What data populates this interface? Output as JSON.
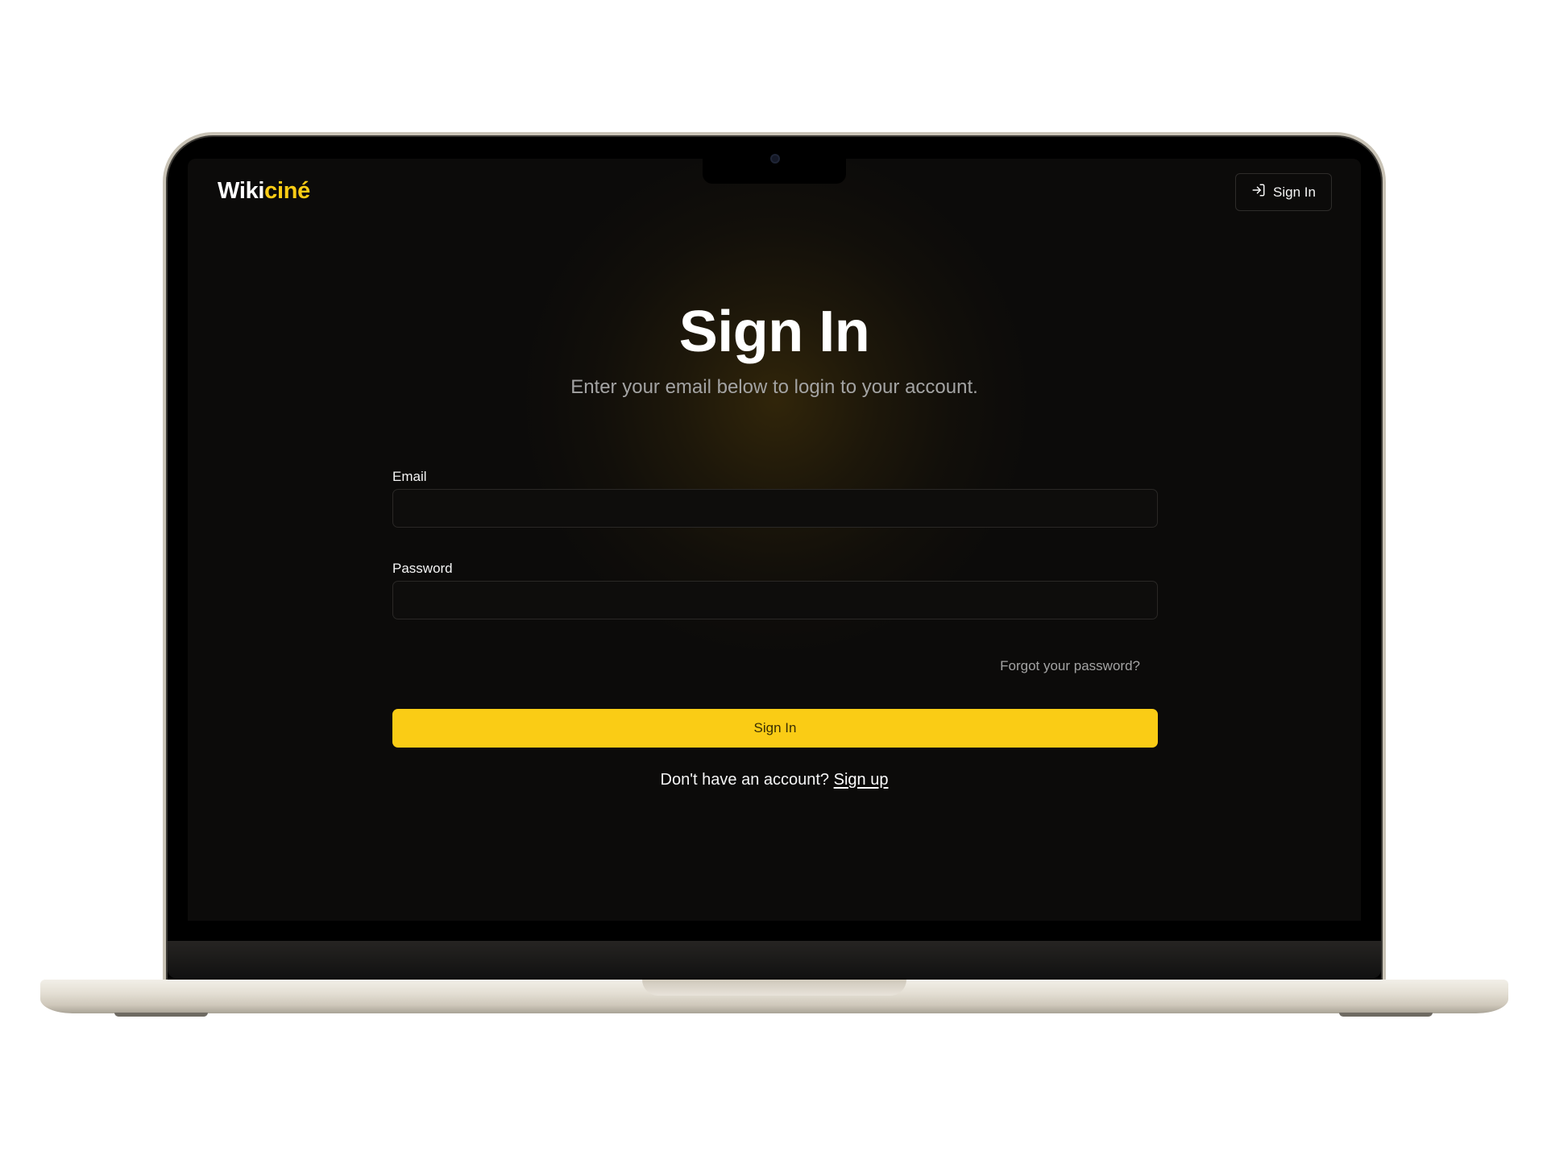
{
  "brand": {
    "name_part1": "Wiki",
    "name_part2": "ciné",
    "accent_color": "#facc15"
  },
  "header": {
    "signin_label": "Sign In",
    "signin_icon": "log-in-icon"
  },
  "main": {
    "title": "Sign In",
    "subtitle": "Enter your email below to login to your account.",
    "email": {
      "label": "Email",
      "value": "",
      "placeholder": ""
    },
    "password": {
      "label": "Password",
      "value": "",
      "placeholder": ""
    },
    "forgot_label": "Forgot your password?",
    "submit_label": "Sign In",
    "signup_prompt": "Don't have an account?",
    "signup_link": "Sign up"
  }
}
